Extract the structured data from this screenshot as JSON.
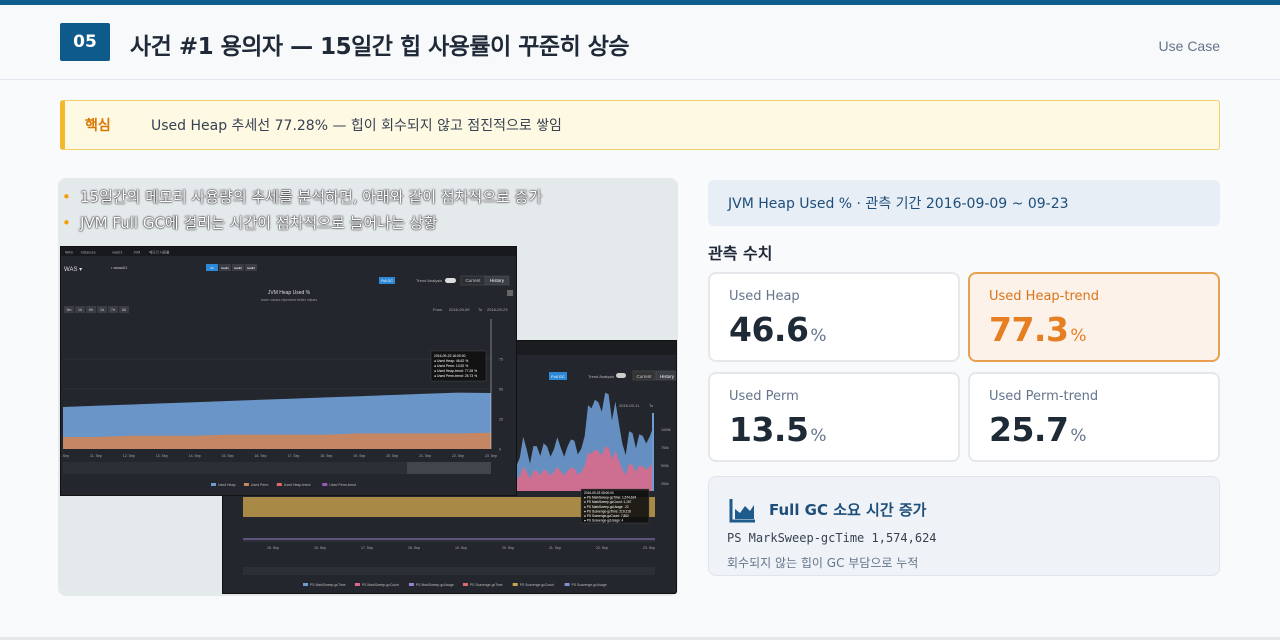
{
  "header": {
    "number": "05",
    "title": "사건 #1 용의자 — 15일간 힙 사용률이 꾸준히 상승",
    "tag": "Use Case"
  },
  "key_point": {
    "label": "핵심",
    "text": "Used Heap 추세선 77.28% — 힙이 회수되지 않고 점진적으로 쌓임"
  },
  "bullets": [
    "15일간의 메모리 사용량의 추세를 분석하면, 아래와 같이 점차적으로 증가",
    "JVM Full GC에 걸리는 시간이 점차적으로 늘어나는 상황"
  ],
  "screen1": {
    "crumbs": [
      "WAS",
      "instances",
      "was01",
      "JVM",
      "메모리 사용률"
    ],
    "agent": "WAS ▾",
    "agent_name": "• awas01",
    "time_btns": [
      "5m",
      "1h",
      "6h",
      "1d",
      "7d",
      "All"
    ],
    "chip_btns": [
      "Mi",
      "lwall1",
      "Iwall2",
      "Iwall3"
    ],
    "fullgc_btn": "Full GC",
    "trend_label": "Trend Analysis",
    "current_tab": "Current",
    "history_tab": "History",
    "chart_title": "JVM Heap Used %",
    "chart_sub": "lower values represent better values",
    "from_label": "From",
    "from_date": "2016-09-09",
    "to_label": "To",
    "to_date": "2016-09-23",
    "tooltip": [
      "2016-09-23 16:00:00",
      "● Used Heap: 46.62 %",
      "● Used Perm: 13.52 %",
      "● Used Heap-trend: 77.28 %",
      "● Used Perm-trend: 25.73 %"
    ],
    "legend": [
      "Used Heap",
      "Used Perm",
      "Used Heap-trend",
      "Used Perm-trend"
    ],
    "x_ticks": [
      "10. Sep",
      "11. Sep",
      "12. Sep",
      "13. Sep",
      "14. Sep",
      "15. Sep",
      "16. Sep",
      "17. Sep",
      "18. Sep",
      "19. Sep",
      "20. Sep",
      "21. Sep",
      "22. Sep",
      "23. Sep"
    ],
    "y_ticks": [
      "75",
      "50",
      "25",
      "0"
    ],
    "chart_data": {
      "type": "area",
      "title": "JVM Heap Used %",
      "x": [
        "10. Sep",
        "11. Sep",
        "12. Sep",
        "13. Sep",
        "14. Sep",
        "15. Sep",
        "16. Sep",
        "17. Sep",
        "18. Sep",
        "19. Sep",
        "20. Sep",
        "21. Sep",
        "22. Sep",
        "23. Sep"
      ],
      "ylim": [
        0,
        100
      ],
      "series": [
        {
          "name": "Used Heap",
          "color": "#6e9bd1",
          "values": [
            35,
            36,
            37,
            38,
            39,
            40,
            41,
            42,
            43,
            44,
            45,
            46,
            47,
            46.62
          ]
        },
        {
          "name": "Used Perm",
          "color": "#c9855e",
          "values": [
            10,
            10,
            11,
            11,
            11,
            12,
            12,
            12,
            12,
            13,
            13,
            13,
            13,
            13.52
          ]
        }
      ]
    }
  },
  "screen2": {
    "fullgc_btn": "Full GC",
    "trend_label": "Trend Analysis",
    "current_tab": "Current",
    "history_tab": "History",
    "from_date": "2016-09-11",
    "to_label": "To",
    "tooltip": [
      "2016-09-23 08:00:00",
      "● PS MarkSweep-gcTime: 1,574,624",
      "● PS MarkSweep-gcCount: 1,157",
      "● PS MarkSweep-gcUsage: .22",
      "● PS Scavenge-gcTime: 219,218",
      "● PS Scavenge-gcCount: 7,862",
      "● PS Scavenge-gcUsage: 4"
    ],
    "legend": [
      "PS MarkSweep-gcTime",
      "PS MarkSweep-gcCount",
      "PS MarkSweep-gcUsage",
      "PS Scavenge-gcTime",
      "PS Scavenge-gcCount",
      "PS Scavenge-gcUsage"
    ],
    "x_ticks": [
      "15. Sep",
      "16. Sep",
      "17. Sep",
      "18. Sep",
      "19. Sep",
      "20. Sep",
      "21. Sep",
      "22. Sep",
      "23. Sep"
    ],
    "y_ticks": [
      "1000k",
      "750k",
      "500k",
      "250k"
    ]
  },
  "observation": {
    "period_text": "JVM Heap Used % · 관측 기간 2016-09-09 ~ 09-23",
    "section_title": "관측 수치",
    "cards": [
      {
        "label": "Used Heap",
        "value": "46.6",
        "unit": "%",
        "highlight": false
      },
      {
        "label": "Used Heap-trend",
        "value": "77.3",
        "unit": "%",
        "highlight": true
      },
      {
        "label": "Used Perm",
        "value": "13.5",
        "unit": "%",
        "highlight": false
      },
      {
        "label": "Used Perm-trend",
        "value": "25.7",
        "unit": "%",
        "highlight": false
      }
    ]
  },
  "gc": {
    "title": "Full GC 소요 시간 증가",
    "code": "PS MarkSweep-gcTime 1,574,624",
    "note": "회수되지 않는 힙이 GC 부담으로 누적",
    "accent": "#1e5b8c"
  }
}
